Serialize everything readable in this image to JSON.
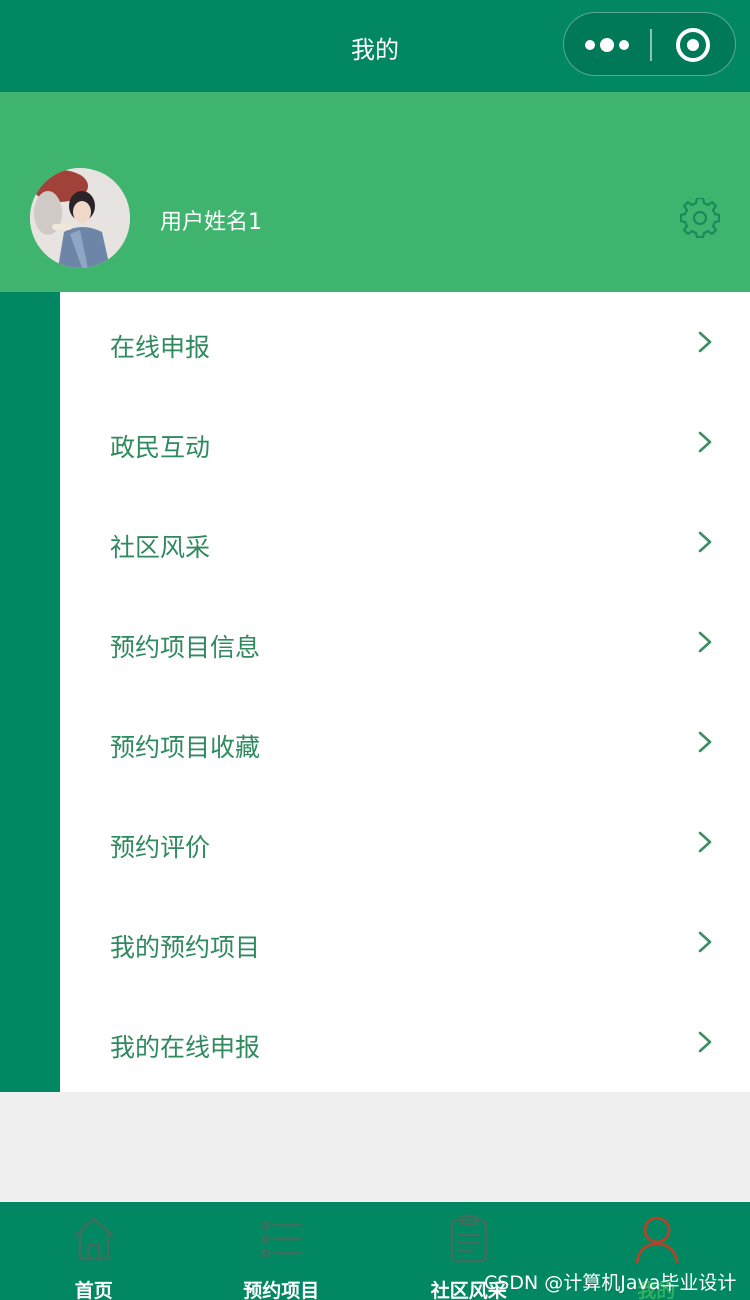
{
  "navbar": {
    "title": "我的",
    "more_icon": "more-dots-icon",
    "close_icon": "target-close-icon"
  },
  "profile": {
    "username": "用户姓名1",
    "settings_icon": "gear-icon"
  },
  "menu": {
    "items": [
      {
        "label": "在线申报"
      },
      {
        "label": "政民互动"
      },
      {
        "label": "社区风采"
      },
      {
        "label": "预约项目信息"
      },
      {
        "label": "预约项目收藏"
      },
      {
        "label": "预约评价"
      },
      {
        "label": "我的预约项目"
      },
      {
        "label": "我的在线申报"
      }
    ]
  },
  "tabbar": {
    "tabs": [
      {
        "label": "首页",
        "icon": "home-icon",
        "active": false
      },
      {
        "label": "预约项目",
        "icon": "list-icon",
        "active": false
      },
      {
        "label": "社区风采",
        "icon": "clipboard-icon",
        "active": false
      },
      {
        "label": "我的",
        "icon": "user-icon",
        "active": true
      }
    ]
  },
  "watermark": "CSDN @计算机Java毕业设计",
  "colors": {
    "primary": "#018762",
    "header_green": "#3fb46e",
    "menu_text": "#2f8a5e",
    "active_tab_icon": "#b3442a",
    "background": "#f0f0f0"
  }
}
